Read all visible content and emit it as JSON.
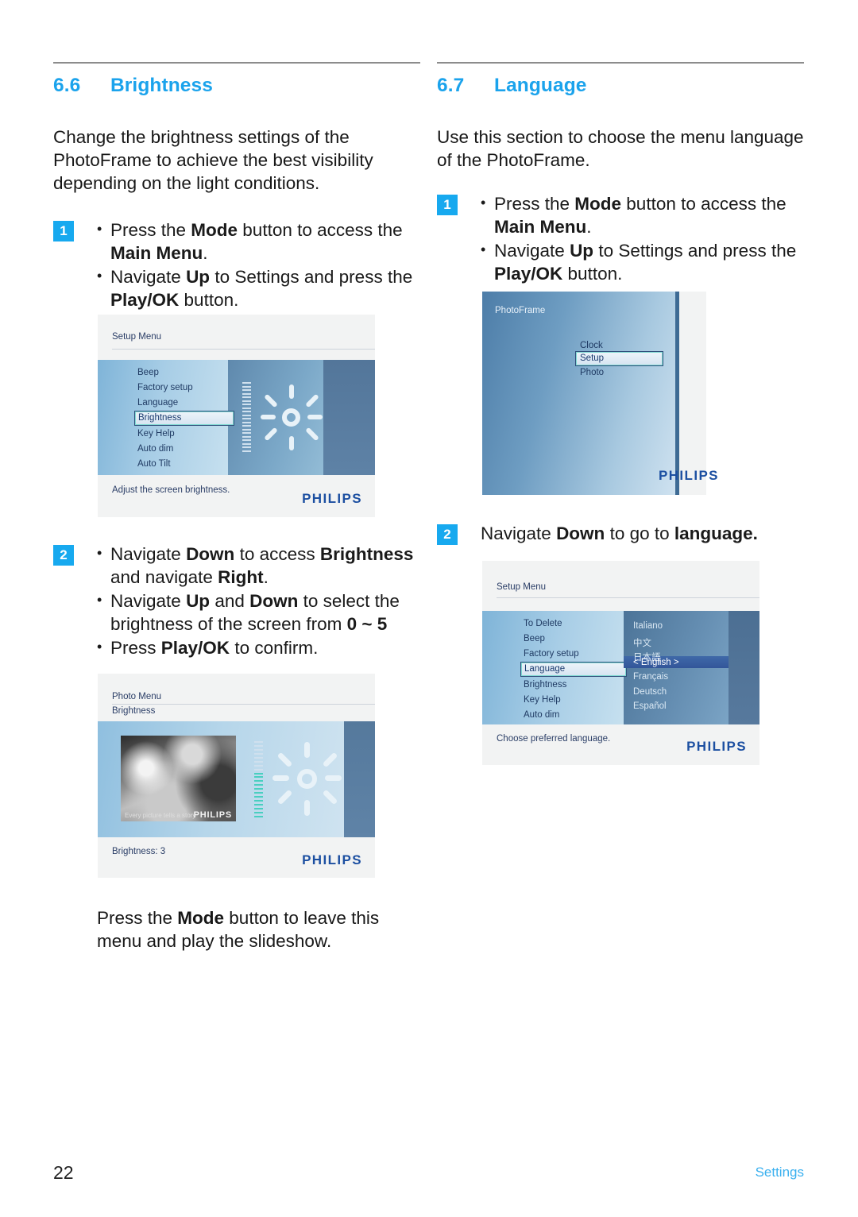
{
  "page": {
    "number": "22",
    "footer_section": "Settings",
    "accent_blue": "#1ba3ec",
    "badge_blue": "#17a9ef"
  },
  "left_column": {
    "section_number": "6.6",
    "section_title": "Brightness",
    "intro": "Change the brightness settings of the PhotoFrame to achieve the best visibility depending on the light conditions.",
    "step1": {
      "badge": "1",
      "bullets": [
        {
          "parts": [
            {
              "t": "Press the ",
              "b": false
            },
            {
              "t": "Mode",
              "b": true
            },
            {
              "t": " button to access the ",
              "b": false
            },
            {
              "t": "Main Menu",
              "b": true
            },
            {
              "t": ".",
              "b": false
            }
          ]
        },
        {
          "parts": [
            {
              "t": "Navigate ",
              "b": false
            },
            {
              "t": "Up",
              "b": true
            },
            {
              "t": " to Settings and press the ",
              "b": false
            },
            {
              "t": "Play/OK",
              "b": true
            },
            {
              "t": " button.",
              "b": false
            }
          ]
        }
      ]
    },
    "step2": {
      "badge": "2",
      "bullets": [
        {
          "parts": [
            {
              "t": "Navigate ",
              "b": false
            },
            {
              "t": "Down",
              "b": true
            },
            {
              "t": " to access ",
              "b": false
            },
            {
              "t": "Brightness",
              "b": true
            },
            {
              "t": " and navigate ",
              "b": false
            },
            {
              "t": "Right",
              "b": true
            },
            {
              "t": ".",
              "b": false
            }
          ]
        },
        {
          "parts": [
            {
              "t": "Navigate ",
              "b": false
            },
            {
              "t": "Up",
              "b": true
            },
            {
              "t": " and ",
              "b": false
            },
            {
              "t": "Down",
              "b": true
            },
            {
              "t": " to select the brightness of the screen from ",
              "b": false
            },
            {
              "t": "0 ~ 5",
              "b": true
            }
          ]
        },
        {
          "parts": [
            {
              "t": "Press ",
              "b": false
            },
            {
              "t": "Play/OK",
              "b": true
            },
            {
              "t": " to confirm.",
              "b": false
            }
          ]
        }
      ]
    },
    "closing": {
      "parts": [
        {
          "t": "Press the ",
          "b": false
        },
        {
          "t": "Mode",
          "b": true
        },
        {
          "t": " button to leave this menu and play the slideshow.",
          "b": false
        }
      ]
    }
  },
  "right_column": {
    "section_number": "6.7",
    "section_title": "Language",
    "intro": "Use this section to choose the menu language of the PhotoFrame.",
    "step1": {
      "badge": "1",
      "bullets": [
        {
          "parts": [
            {
              "t": "Press the ",
              "b": false
            },
            {
              "t": "Mode",
              "b": true
            },
            {
              "t": " button to access the ",
              "b": false
            },
            {
              "t": "Main Menu",
              "b": true
            },
            {
              "t": ".",
              "b": false
            }
          ]
        },
        {
          "parts": [
            {
              "t": "Navigate ",
              "b": false
            },
            {
              "t": "Up",
              "b": true
            },
            {
              "t": " to Settings and press the ",
              "b": false
            },
            {
              "t": "Play/OK",
              "b": true
            },
            {
              "t": " button.",
              "b": false
            }
          ]
        }
      ]
    },
    "step2": {
      "badge": "2",
      "parts": [
        {
          "t": "Navigate ",
          "b": false
        },
        {
          "t": "Down",
          "b": true
        },
        {
          "t": " to go to ",
          "b": false
        },
        {
          "t": "language.",
          "b": true
        }
      ]
    }
  },
  "screenshots": {
    "setup_brightness": {
      "title": "Setup Menu",
      "items": [
        "Beep",
        "Factory setup",
        "Language",
        "Brightness",
        "Key Help",
        "Auto dim",
        "Auto Tilt"
      ],
      "selected": "Brightness",
      "caption": "Adjust the screen brightness.",
      "brand": "PHILIPS"
    },
    "photo_brightness": {
      "title": "Photo Menu",
      "subtitle": "Brightness",
      "photo_slogan": "Every picture tells a story",
      "photo_brand": "PHILIPS",
      "caption": "Brightness: 3",
      "brand": "PHILIPS",
      "level": 3,
      "level_max": 5
    },
    "main_menu": {
      "title": "PhotoFrame",
      "items": [
        "Clock",
        "Setup",
        "Photo"
      ],
      "selected": "Setup",
      "brand": "PHILIPS"
    },
    "setup_language": {
      "title": "Setup Menu",
      "items": [
        "To Delete",
        "Beep",
        "Factory setup",
        "Language",
        "Brightness",
        "Key Help",
        "Auto dim"
      ],
      "selected": "Language",
      "languages": [
        "Italiano",
        "中文",
        "日本語",
        "< English >",
        "Français",
        "Deutsch",
        "Español"
      ],
      "selected_language": "< English >",
      "caption": "Choose preferred language.",
      "brand": "PHILIPS"
    }
  }
}
